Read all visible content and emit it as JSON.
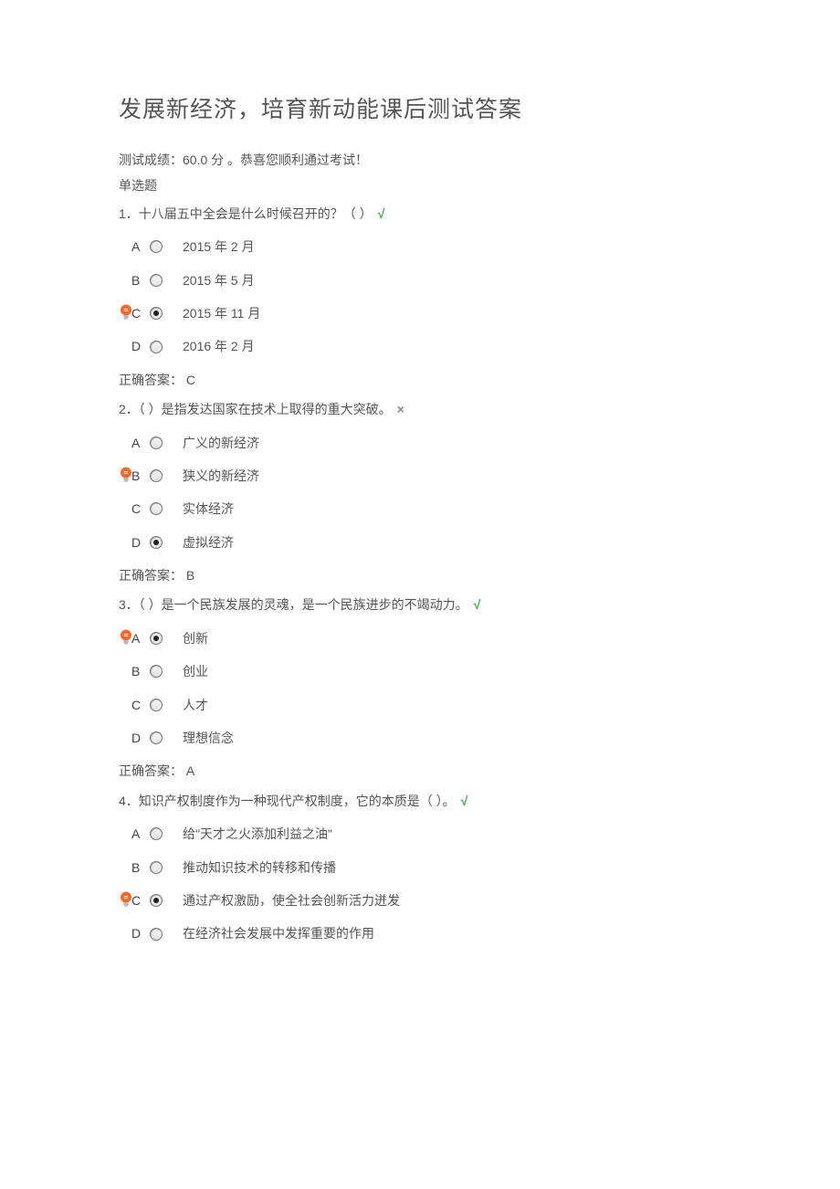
{
  "title": "发展新经济，培育新动能课后测试答案",
  "score_line": "测试成绩：60.0 分 。恭喜您顺利通过考试！",
  "section_label": "单选题",
  "answer_prefix": "正确答案：",
  "questions": [
    {
      "num": "1．",
      "text": "十八届五中全会是什么时候召开的？（  ）",
      "mark": "√",
      "mark_class": "correct",
      "options": [
        {
          "letter": "A",
          "text": "2015 年 2 月",
          "selected": false,
          "bulb": false
        },
        {
          "letter": "B",
          "text": "2015 年 5 月",
          "selected": false,
          "bulb": false
        },
        {
          "letter": "C",
          "text": "2015 年 11 月",
          "selected": true,
          "bulb": true
        },
        {
          "letter": "D",
          "text": "2016 年 2 月",
          "selected": false,
          "bulb": false
        }
      ],
      "answer": " C"
    },
    {
      "num": "2．",
      "text": "（  ）是指发达国家在技术上取得的重大突破。",
      "mark": "×",
      "mark_class": "wrong",
      "options": [
        {
          "letter": "A",
          "text": "广义的新经济",
          "selected": false,
          "bulb": false
        },
        {
          "letter": "B",
          "text": "狭义的新经济",
          "selected": false,
          "bulb": true
        },
        {
          "letter": "C",
          "text": "实体经济",
          "selected": false,
          "bulb": false
        },
        {
          "letter": "D",
          "text": "虚拟经济",
          "selected": true,
          "bulb": false
        }
      ],
      "answer": " B"
    },
    {
      "num": "3．",
      "text": "（  ）是一个民族发展的灵魂，是一个民族进步的不竭动力。",
      "mark": "√",
      "mark_class": "correct",
      "options": [
        {
          "letter": "A",
          "text": "创新",
          "selected": true,
          "bulb": true
        },
        {
          "letter": "B",
          "text": "创业",
          "selected": false,
          "bulb": false
        },
        {
          "letter": "C",
          "text": "人才",
          "selected": false,
          "bulb": false
        },
        {
          "letter": "D",
          "text": "理想信念",
          "selected": false,
          "bulb": false
        }
      ],
      "answer": " A"
    },
    {
      "num": "4．",
      "text": "知识产权制度作为一种现代产权制度，它的本质是（  ）。",
      "mark": "√",
      "mark_class": "correct",
      "options": [
        {
          "letter": "A",
          "text": "给\"天才之火添加利益之油\"",
          "selected": false,
          "bulb": false
        },
        {
          "letter": "B",
          "text": "推动知识技术的转移和传播",
          "selected": false,
          "bulb": false
        },
        {
          "letter": "C",
          "text": "通过产权激励，使全社会创新活力迸发",
          "selected": true,
          "bulb": true
        },
        {
          "letter": "D",
          "text": "在经济社会发展中发挥重要的作用",
          "selected": false,
          "bulb": false
        }
      ],
      "answer": null
    }
  ]
}
